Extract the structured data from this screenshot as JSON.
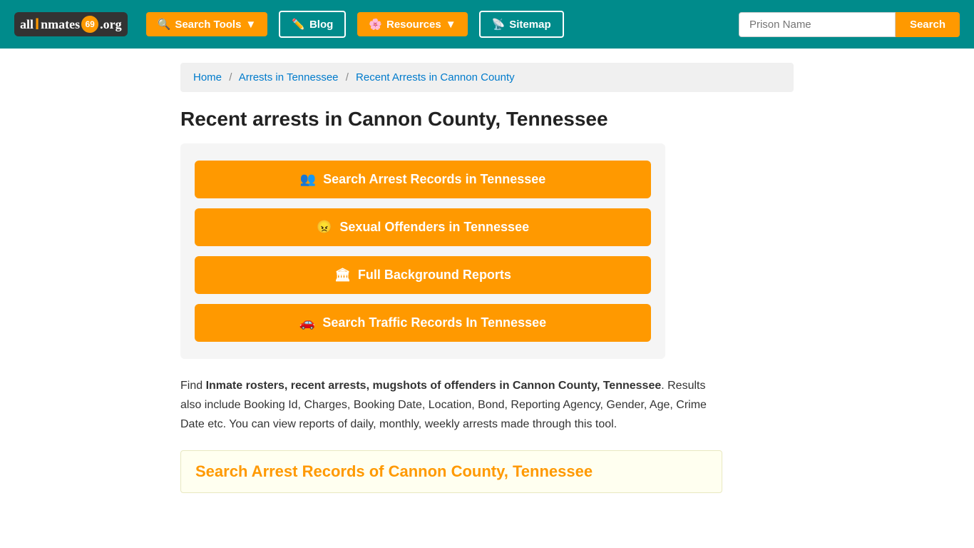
{
  "header": {
    "logo": {
      "all": "all",
      "i": "I",
      "nmates": "nmates",
      "dot_label": "69",
      "org": ".org"
    },
    "nav": [
      {
        "id": "search-tools",
        "label": "Search Tools",
        "icon": "🔍",
        "dropdown": true
      },
      {
        "id": "blog",
        "label": "Blog",
        "icon": "✏️",
        "dropdown": false
      },
      {
        "id": "resources",
        "label": "Resources",
        "icon": "🌸",
        "dropdown": true
      },
      {
        "id": "sitemap",
        "label": "Sitemap",
        "icon": "📡",
        "dropdown": false
      }
    ],
    "search_placeholder": "Prison Name",
    "search_button": "Search"
  },
  "breadcrumb": {
    "items": [
      {
        "label": "Home",
        "href": "#"
      },
      {
        "label": "Arrests in Tennessee",
        "href": "#"
      },
      {
        "label": "Recent Arrests in Cannon County",
        "href": "#"
      }
    ]
  },
  "page": {
    "title": "Recent arrests in Cannon County, Tennessee",
    "buttons": [
      {
        "id": "search-arrests",
        "label": "Search Arrest Records in Tennessee",
        "icon": "👥"
      },
      {
        "id": "sexual-offenders",
        "label": "Sexual Offenders in Tennessee",
        "icon": "😠"
      },
      {
        "id": "background-reports",
        "label": "Full Background Reports",
        "icon": "🏛"
      },
      {
        "id": "traffic-records",
        "label": "Search Traffic Records In Tennessee",
        "icon": "🚗"
      }
    ],
    "description_intro": "Find ",
    "description_bold1": "Inmate rosters, recent arrests, mugshots of offenders in Cannon County, Tennessee",
    "description_rest": ". Results also include Booking Id, Charges, Booking Date, Location, Bond, Reporting Agency, Gender, Age, Crime Date etc. You can view reports of daily, monthly, weekly arrests made through this tool.",
    "section_title": "Search Arrest Records of Cannon County, Tennessee"
  }
}
